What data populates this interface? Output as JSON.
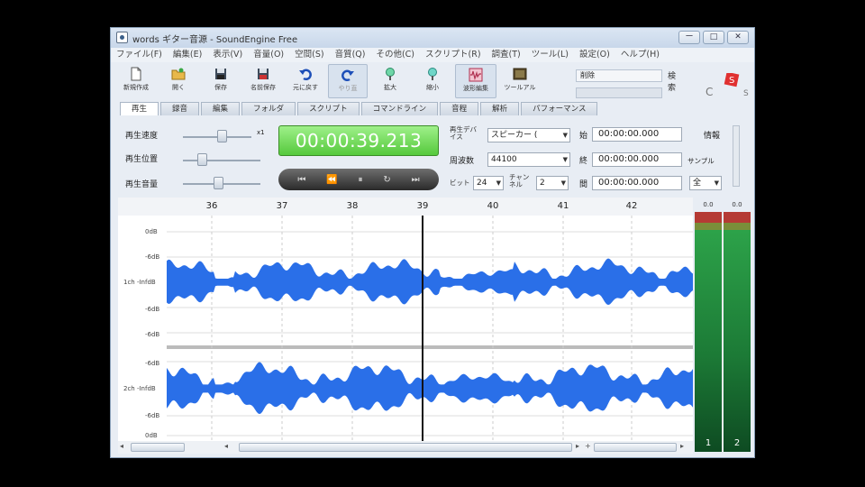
{
  "window": {
    "title": "words ギター音源 - SoundEngine Free",
    "controls": [
      "ー",
      "□",
      "✕"
    ]
  },
  "menu": [
    "ファイル(F)",
    "編集(E)",
    "表示(V)",
    "音量(O)",
    "空間(S)",
    "音質(Q)",
    "その他(C)",
    "スクリプト(R)",
    "調査(T)",
    "ツール(L)",
    "設定(O)",
    "ヘルプ(H)"
  ],
  "toolbar": [
    {
      "label": "新規作成",
      "icon": "new-file-icon"
    },
    {
      "label": "開く",
      "icon": "open-folder-icon"
    },
    {
      "label": "保存",
      "icon": "save-icon"
    },
    {
      "label": "名前保存",
      "icon": "save-as-icon"
    },
    {
      "label": "元に戻す",
      "icon": "undo-icon"
    },
    {
      "label": "やり直",
      "icon": "redo-icon"
    },
    {
      "label": "拡大",
      "icon": "zoom-in-icon"
    },
    {
      "label": "縮小",
      "icon": "zoom-out-icon"
    },
    {
      "label": "波形編集",
      "icon": "wave-edit-icon"
    },
    {
      "label": "ツールアル",
      "icon": "tool-icon"
    }
  ],
  "top_right": {
    "status_label": "削除",
    "search_label": "検索"
  },
  "tabs": [
    "再生",
    "録音",
    "編集",
    "フォルダ",
    "スクリプト",
    "コマンドライン",
    "音程",
    "解析",
    "パフォーマンス"
  ],
  "play_panel": {
    "speed_label": "再生速度",
    "speed_value": "x1",
    "position_label": "再生位置",
    "volume_label": "再生音量",
    "time": "00:00:39.213",
    "device_label": "再生デバイス",
    "device_value": "スピーカー (",
    "freq_label": "周波数",
    "freq_value": "44100",
    "bit_label": "ビット",
    "bit_value": "24",
    "channel_label": "チャンネル",
    "channel_value": "2",
    "start_label": "始",
    "start_value": "00:00:00.000",
    "end_label": "終",
    "end_value": "00:00:00.000",
    "len_label": "間",
    "len_value": "00:00:00.000",
    "info_label": "情報",
    "sample_label": "サンプル",
    "all_value": "全"
  },
  "timeline": {
    "ticks": [
      "36",
      "37",
      "38",
      "39",
      "40",
      "41",
      "42"
    ]
  },
  "tracks": [
    {
      "name": "1ch -InfdB",
      "db_labels": [
        "0dB",
        "-6dB",
        "-6dB",
        "-6dB"
      ]
    },
    {
      "name": "2ch -InfdB",
      "db_labels": [
        "-6dB",
        "-6dB",
        "-6dB",
        "0dB"
      ]
    }
  ],
  "meters": [
    {
      "label": "1",
      "peak": "0.0",
      "level": 0.85
    },
    {
      "label": "2",
      "peak": "0.0",
      "level": 0.85
    }
  ],
  "colors": {
    "wave": "#2a6fe8",
    "lcd": "#5fd045"
  }
}
